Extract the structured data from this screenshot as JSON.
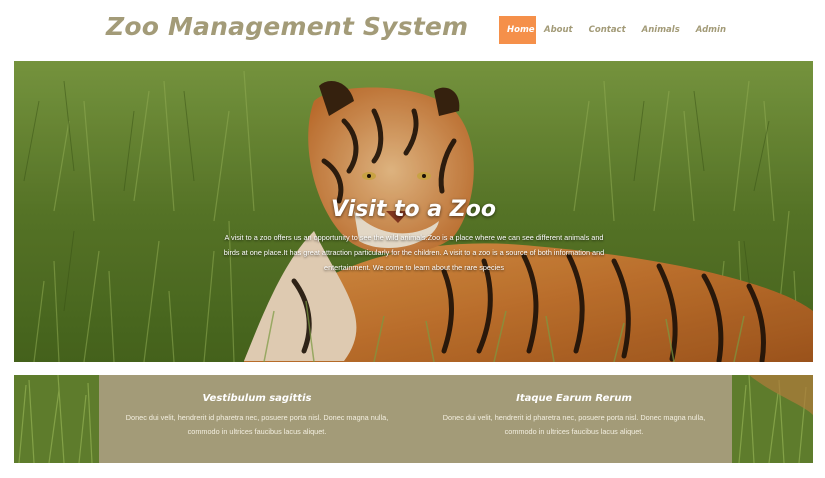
{
  "header": {
    "site_title": "Zoo Management System",
    "nav": [
      {
        "label": "Home",
        "active": true
      },
      {
        "label": "About",
        "active": false
      },
      {
        "label": "Contact",
        "active": false
      },
      {
        "label": "Animals",
        "active": false
      },
      {
        "label": "Admin",
        "active": false
      }
    ]
  },
  "hero": {
    "title": "Visit to a Zoo",
    "text": "A visit to a zoo offers us an opportunity to see the wild animals.Zoo is a place where we can see different animals and birds at one place.It has great attraction particularly for the children. A visit to a zoo is a source of both information and entertainment. We come to learn about the rare species"
  },
  "features": [
    {
      "title": "Vestibulum sagittis",
      "text": "Donec dui velit, hendrerit id pharetra nec, posuere porta nisl. Donec magna nulla, commodo in ultrices faucibus lacus aliquet."
    },
    {
      "title": "Itaque Earum Rerum",
      "text": "Donec dui velit, hendrerit id pharetra nec, posuere porta nisl. Donec magna nulla, commodo in ultrices faucibus lacus aliquet."
    }
  ],
  "colors": {
    "accent": "#f5904a",
    "brand": "#a39b78",
    "white": "#ffffff"
  }
}
